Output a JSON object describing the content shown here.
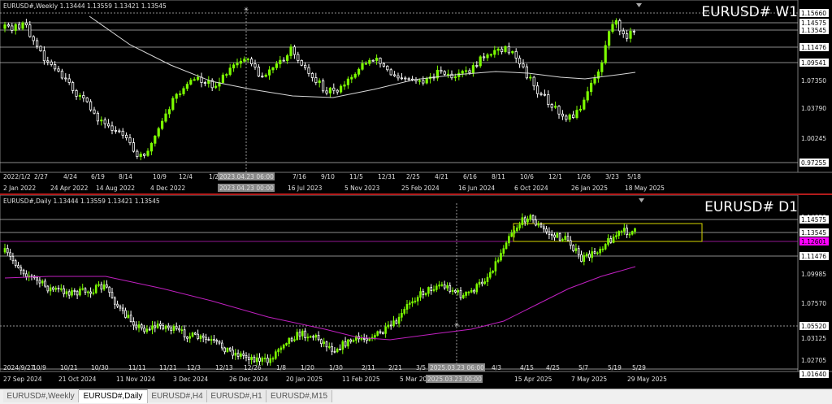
{
  "weekly": {
    "header": "EURUSD#,Weekly  1.13444 1.13559 1.13421 1.13545",
    "title": "EURUSD# W1",
    "price_labels": [
      "1.15660",
      "1.14575",
      "1.13545",
      "1.11476",
      "1.09541",
      "1.07350",
      "1.03790",
      "1.00245",
      "0.97255"
    ],
    "hlines": [
      {
        "price": "1.15660",
        "style": "dotted"
      },
      {
        "price": "1.14575",
        "style": "solid"
      },
      {
        "price": "1.13545",
        "style": "solid"
      },
      {
        "price": "1.11476",
        "style": "solid"
      },
      {
        "price": "1.09541",
        "style": "solid"
      },
      {
        "price": "0.97255",
        "style": "solid"
      }
    ],
    "top_dates": [
      "2022/1/2",
      "2/27",
      "4/24",
      "6/19",
      "8/14",
      "10/9",
      "12/4",
      "1/29",
      "2023.04.23 06:00",
      "7/16",
      "9/10",
      "11/5",
      "12/31",
      "2/25",
      "4/21",
      "6/16",
      "8/11",
      "10/6",
      "12/1",
      "1/26",
      "3/23",
      "5/18"
    ],
    "bottom_dates": [
      "2 Jan 2022",
      "24 Apr 2022",
      "14 Aug 2022",
      "4 Dec 2022",
      "2023.04.23 00:00",
      "16 Jul 2023",
      "5 Nov 2023",
      "25 Feb 2024",
      "16 Jun 2024",
      "6 Oct 2024",
      "26 Jan 2025",
      "18 May 2025"
    ]
  },
  "daily": {
    "header": "EURUSD#,Daily  1.13444 1.13559 1.13421 1.13545",
    "title": "EURUSD# D1",
    "price_labels": [
      "1.14850",
      "1.14575",
      "1.13545",
      "1.12601",
      "1.11476",
      "1.09985",
      "1.07570",
      "1.05520",
      "1.03125",
      "1.02705",
      "1.01640"
    ],
    "top_dates": [
      "2024/9/27",
      "10/9",
      "10/21",
      "10/30",
      "11/11",
      "11/21",
      "12/3",
      "12/13",
      "12/26",
      "1/8",
      "1/20",
      "1/30",
      "2/11",
      "2/21",
      "3/5",
      "2025.03.23 06:00",
      "4/3",
      "4/15",
      "4/25",
      "5/7",
      "5/19",
      "5/29"
    ],
    "bottom_dates": [
      "27 Sep 2024",
      "21 Oct 2024",
      "11 Nov 2024",
      "3 Dec 2024",
      "26 Dec 2024",
      "20 Jan 2025",
      "11 Feb 2025",
      "5 Mar 2025",
      "2025.03.23 00:00",
      "15 Apr 2025",
      "7 May 2025",
      "29 May 2025"
    ]
  },
  "tabs": [
    {
      "label": "EURUSD#,Weekly",
      "active": false
    },
    {
      "label": "EURUSD#,Daily",
      "active": true
    },
    {
      "label": "EURUSD#,H4",
      "active": false
    },
    {
      "label": "EURUSD#,H1",
      "active": false
    },
    {
      "label": "EURUSD#,M15",
      "active": false
    }
  ],
  "colors": {
    "bull": "#7cfc00",
    "bear": "#ffffff",
    "ma_weekly": "#d8d8d8",
    "ma_daily": "#c020c0",
    "rect": "#d6d600",
    "highlight_label": "#ff00ff",
    "crosshair": "#e0c000"
  }
}
